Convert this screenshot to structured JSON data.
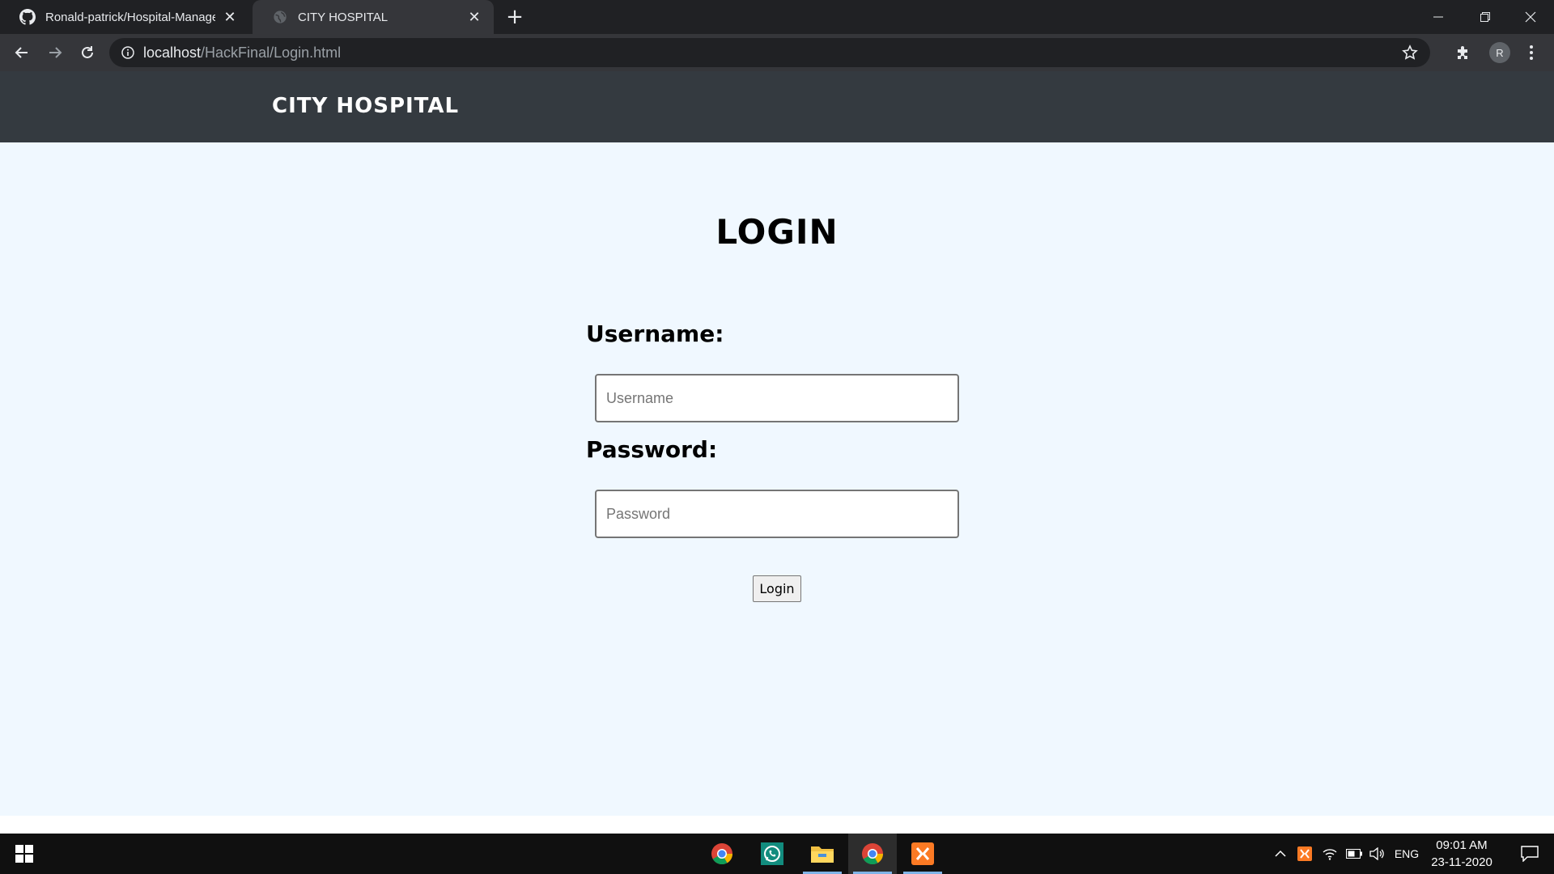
{
  "browser": {
    "tabs": [
      {
        "title": "Ronald-patrick/Hospital-Management",
        "icon": "github-icon",
        "active": false
      },
      {
        "title": "CITY HOSPITAL",
        "icon": "globe-icon",
        "active": true
      }
    ],
    "url_host": "localhost",
    "url_path": "/HackFinal/Login.html",
    "profile_initial": "R"
  },
  "page": {
    "brand": "CITY HOSPITAL",
    "title": "LOGIN",
    "username_label": "Username:",
    "username_placeholder": "Username",
    "password_label": "Password:",
    "password_placeholder": "Password",
    "login_button": "Login",
    "colors": {
      "header_bg": "#343a40",
      "page_bg": "#f0f8ff"
    }
  },
  "taskbar": {
    "apps": [
      "chrome-icon",
      "whatsapp-icon",
      "file-explorer-icon",
      "chrome-icon",
      "xampp-icon"
    ],
    "language": "ENG",
    "time": "09:01 AM",
    "date": "23-11-2020"
  }
}
